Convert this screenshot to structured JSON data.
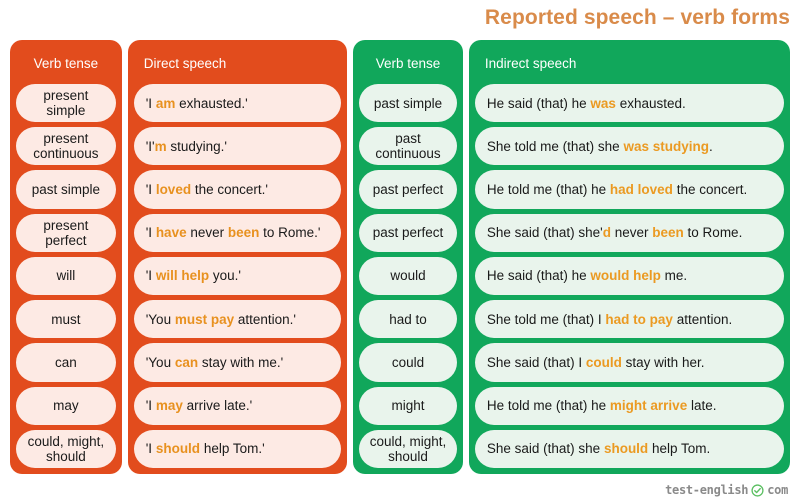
{
  "title": "Reported speech – verb forms",
  "colors": {
    "orange": "#e24c1d",
    "green": "#11a75b",
    "orange_cell": "#fdeae4",
    "green_cell": "#e9f4ec",
    "title_color": "#d98b4a",
    "highlight": "#e8911f"
  },
  "columns": {
    "direct_tense": {
      "header": "Verb tense"
    },
    "direct_speech": {
      "header": "Direct speech"
    },
    "indirect_tense": {
      "header": "Verb tense"
    },
    "indirect_speech": {
      "header": "Indirect speech"
    }
  },
  "rows": [
    {
      "direct_tense": "present\nsimple",
      "direct_speech": [
        {
          "t": "'I ",
          "hl": false
        },
        {
          "t": "am",
          "hl": true
        },
        {
          "t": " exhausted.'",
          "hl": false
        }
      ],
      "indirect_tense": "past simple",
      "indirect_speech": [
        {
          "t": "He said (that) he ",
          "hl": false
        },
        {
          "t": "was",
          "hl": true
        },
        {
          "t": " exhausted.",
          "hl": false
        }
      ]
    },
    {
      "direct_tense": "present\ncontinuous",
      "direct_speech": [
        {
          "t": "'I'",
          "hl": false
        },
        {
          "t": "m",
          "hl": true
        },
        {
          "t": " studying.'",
          "hl": false
        }
      ],
      "indirect_tense": "past\ncontinuous",
      "indirect_speech": [
        {
          "t": "She told me (that) she ",
          "hl": false
        },
        {
          "t": "was studying",
          "hl": true
        },
        {
          "t": ".",
          "hl": false
        }
      ]
    },
    {
      "direct_tense": "past simple",
      "direct_speech": [
        {
          "t": "'I ",
          "hl": false
        },
        {
          "t": "loved",
          "hl": true
        },
        {
          "t": " the concert.'",
          "hl": false
        }
      ],
      "indirect_tense": "past perfect",
      "indirect_speech": [
        {
          "t": "He told me (that) he ",
          "hl": false
        },
        {
          "t": "had loved",
          "hl": true
        },
        {
          "t": " the concert.",
          "hl": false
        }
      ]
    },
    {
      "direct_tense": "present\nperfect",
      "direct_speech": [
        {
          "t": "'I ",
          "hl": false
        },
        {
          "t": "have",
          "hl": true
        },
        {
          "t": " never ",
          "hl": false
        },
        {
          "t": "been",
          "hl": true
        },
        {
          "t": " to Rome.'",
          "hl": false
        }
      ],
      "indirect_tense": "past perfect",
      "indirect_speech": [
        {
          "t": "She said (that) she'",
          "hl": false
        },
        {
          "t": "d",
          "hl": true
        },
        {
          "t": " never ",
          "hl": false
        },
        {
          "t": "been",
          "hl": true
        },
        {
          "t": " to Rome.",
          "hl": false
        }
      ]
    },
    {
      "direct_tense": "will",
      "direct_speech": [
        {
          "t": "'I ",
          "hl": false
        },
        {
          "t": "will help",
          "hl": true
        },
        {
          "t": " you.'",
          "hl": false
        }
      ],
      "indirect_tense": "would",
      "indirect_speech": [
        {
          "t": "He said (that) he ",
          "hl": false
        },
        {
          "t": "would help",
          "hl": true
        },
        {
          "t": " me.",
          "hl": false
        }
      ]
    },
    {
      "direct_tense": "must",
      "direct_speech": [
        {
          "t": "'You ",
          "hl": false
        },
        {
          "t": "must pay",
          "hl": true
        },
        {
          "t": " attention.'",
          "hl": false
        }
      ],
      "indirect_tense": "had to",
      "indirect_speech": [
        {
          "t": "She told me (that) I ",
          "hl": false
        },
        {
          "t": "had to pay",
          "hl": true
        },
        {
          "t": " attention.",
          "hl": false
        }
      ]
    },
    {
      "direct_tense": "can",
      "direct_speech": [
        {
          "t": "'You ",
          "hl": false
        },
        {
          "t": "can",
          "hl": true
        },
        {
          "t": " stay with me.'",
          "hl": false
        }
      ],
      "indirect_tense": "could",
      "indirect_speech": [
        {
          "t": "She said (that) I ",
          "hl": false
        },
        {
          "t": "could",
          "hl": true
        },
        {
          "t": " stay with her.",
          "hl": false
        }
      ]
    },
    {
      "direct_tense": "may",
      "direct_speech": [
        {
          "t": "'I ",
          "hl": false
        },
        {
          "t": "may",
          "hl": true
        },
        {
          "t": " arrive late.'",
          "hl": false
        }
      ],
      "indirect_tense": "might",
      "indirect_speech": [
        {
          "t": "He told me (that) he ",
          "hl": false
        },
        {
          "t": "might arrive",
          "hl": true
        },
        {
          "t": " late.",
          "hl": false
        }
      ]
    },
    {
      "direct_tense": "could, might,\nshould",
      "direct_speech": [
        {
          "t": "'I ",
          "hl": false
        },
        {
          "t": "should",
          "hl": true
        },
        {
          "t": " help Tom.'",
          "hl": false
        }
      ],
      "indirect_tense": "could, might,\nshould",
      "indirect_speech": [
        {
          "t": "She said (that) she ",
          "hl": false
        },
        {
          "t": "should",
          "hl": true
        },
        {
          "t": " help Tom.",
          "hl": false
        }
      ]
    }
  ],
  "footer": {
    "logo_left": "test-english",
    "logo_icon": "check-circle-icon",
    "logo_right": "com"
  }
}
